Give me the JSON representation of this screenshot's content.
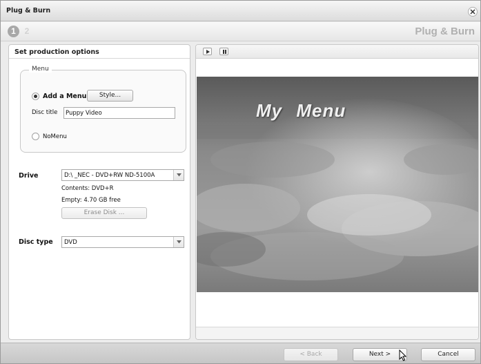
{
  "window": {
    "title": "Plug & Burn"
  },
  "steps": [
    {
      "label": "1"
    },
    {
      "label": "2"
    }
  ],
  "brand": "Plug & Burn",
  "left_panel": {
    "heading": "Set production options",
    "menu_group": {
      "legend": "Menu",
      "add_menu_label": "Add a Menu",
      "style_button": "Style...",
      "disc_title_label": "Disc title",
      "disc_title_value": "Puppy Video",
      "no_menu_label": "NoMenu",
      "selected": "Add a Menu"
    },
    "drive": {
      "label": "Drive",
      "selected": "D:\\ _NEC - DVD+RW ND-5100A",
      "contents": "Contents: DVD+R",
      "empty": "Empty: 4.70 GB free",
      "erase_button": "Erase Disk ..."
    },
    "disc_type": {
      "label": "Disc type",
      "selected": "DVD"
    }
  },
  "preview": {
    "menu_title": "My Menu",
    "controls": [
      "play-icon",
      "pause-icon"
    ]
  },
  "buttons": {
    "back": "< Back",
    "next": "Next >",
    "cancel": "Cancel"
  }
}
